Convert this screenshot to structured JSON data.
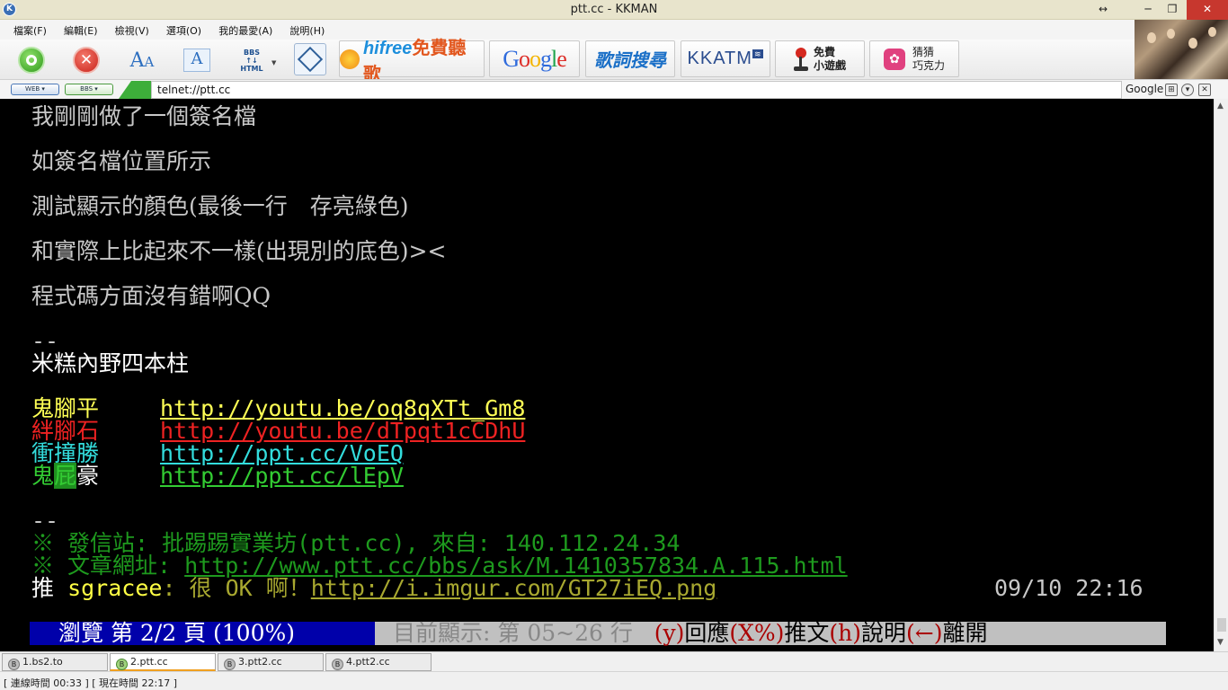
{
  "window": {
    "title": "ptt.cc - KKMAN",
    "app_icon": "kkman-icon",
    "controls": {
      "resize": "↔",
      "minimize": "─",
      "restore": "❐",
      "close": "✕"
    }
  },
  "menu": [
    "檔案(F)",
    "編輯(E)",
    "檢視(V)",
    "選項(O)",
    "我的最愛(A)",
    "說明(H)"
  ],
  "toolbar": {
    "font_a_big": "A",
    "font_a_small": "A",
    "font_box": "A",
    "bbs_html_line1": "BBS",
    "bbs_html_line2": "↑↓",
    "bbs_html_line3": "HTML",
    "stop_glyph": "✕",
    "hifree_brand": "hifree",
    "hifree_text": "免費聽歌",
    "google": [
      "G",
      "o",
      "o",
      "g",
      "l",
      "e"
    ],
    "dict": "歌詞搜尋",
    "kkatm": "KKATM",
    "kkatm_badge": "≋",
    "game_line1": "免費",
    "game_line2": "小遊戲",
    "guess_line1": "猜猜",
    "guess_line2": "巧克力",
    "flower_glyph": "✿"
  },
  "address": {
    "web_btn": "WEB ▾",
    "bbs_btn": "BBS ▾",
    "url": "telnet://ptt.cc",
    "search_engine": "Google",
    "icons": [
      "⊞",
      "▾",
      "✕"
    ]
  },
  "terminal": {
    "lines": [
      "我剛剛做了一個簽名檔",
      "如簽名檔位置所示",
      "測試顯示的顏色(最後一行　存亮綠色)",
      "和實際上比起來不一樣(出現別的底色)><",
      "程式碼方面沒有錯啊QQ"
    ],
    "sig_sep": "--",
    "sig_title": "米糕內野四本柱",
    "players": [
      {
        "name": "鬼腳平",
        "url": "http://youtu.be/oq8qXTt_Gm8"
      },
      {
        "name": "絆腳石",
        "url": "http://youtu.be/dTpqt1cCDhU"
      },
      {
        "name": "衝撞勝",
        "url": "http://ppt.cc/VoEQ"
      },
      {
        "name_a": "鬼",
        "name_b": "屁",
        "name_c": "豪",
        "url": "http://ppt.cc/lEpV"
      }
    ],
    "footer_sep": "--",
    "origin": "※ 發信站: 批踢踢實業坊(ptt.cc), 來自: 140.112.24.34",
    "article_label": "※ 文章網址: ",
    "article_url": "http://www.ptt.cc/bbs/ask/M.1410357834.A.115.html",
    "push": {
      "tag": "推",
      "user": "sgracee",
      "text": ": 很 OK 啊！",
      "url": "http://i.imgur.com/GT27iEQ.png",
      "time": "09/10 22:16"
    },
    "status_left": "瀏覽 第 2/2 頁 (100%)",
    "status_mid": "目前顯示: 第 05~26 行",
    "status_keys": [
      {
        "k": "(y)",
        "t": "回應"
      },
      {
        "k": "(X%)",
        "t": "推文"
      },
      {
        "k": "(h)",
        "t": "說明"
      },
      {
        "k": "(←)",
        "t": "離開"
      }
    ]
  },
  "scrollbar": {
    "up": "▲",
    "down": "▼"
  },
  "tabs": [
    {
      "label": "1.bs2.to",
      "icon": "B"
    },
    {
      "label": "2.ptt.cc",
      "icon": "B"
    },
    {
      "label": "3.ptt2.cc",
      "icon": "B"
    },
    {
      "label": "4.ptt2.cc",
      "icon": "B"
    }
  ],
  "statusbar": "[ 連線時間 00:33 ] [ 現在時間 22:17 ]"
}
